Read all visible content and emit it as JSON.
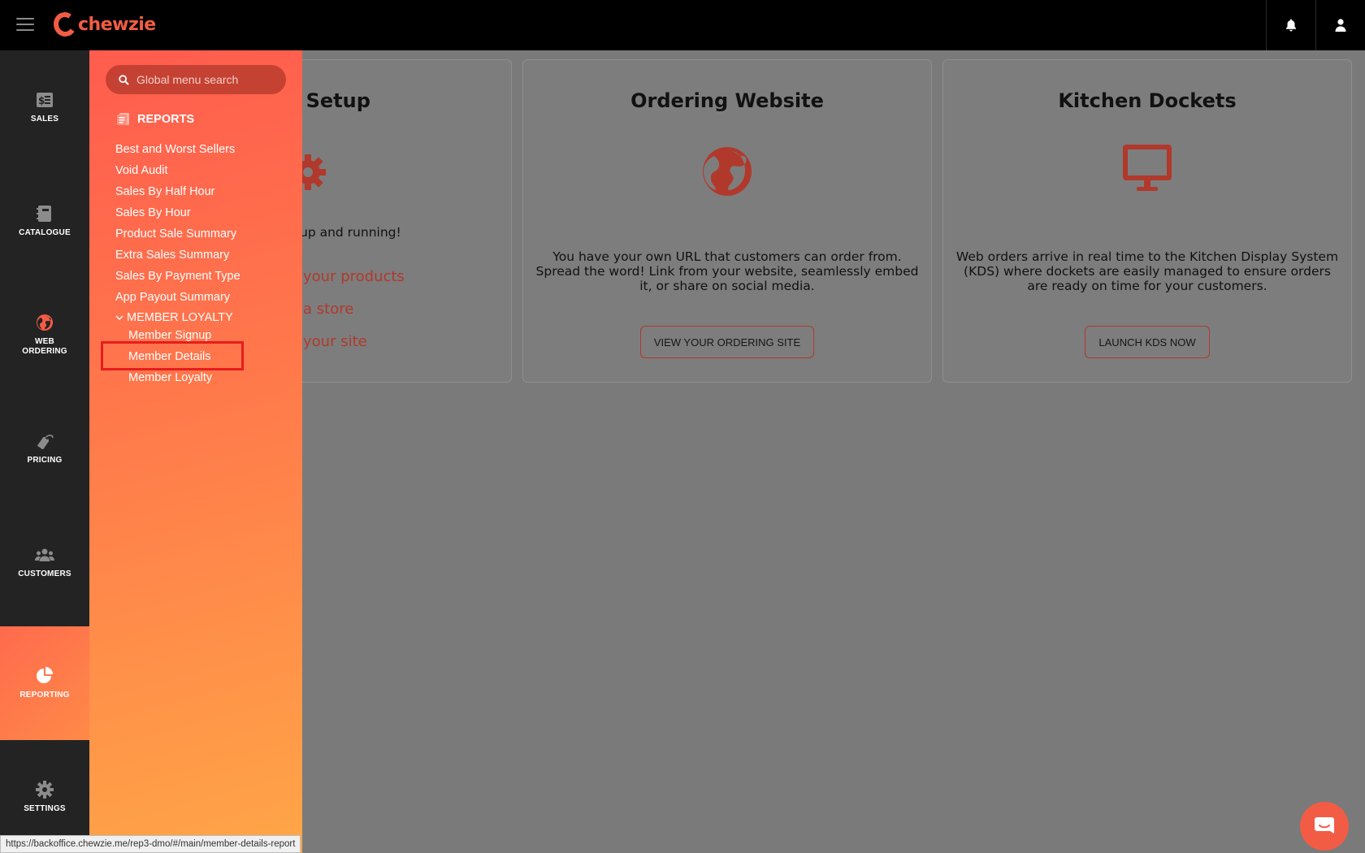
{
  "brand": {
    "name": "chewzie"
  },
  "topbar": {
    "notifications_icon": "bell-icon",
    "user_icon": "user-icon"
  },
  "nav": {
    "items": [
      {
        "label": "SALES",
        "icon": "sales-receipt-icon"
      },
      {
        "label": "CATALOGUE",
        "icon": "notebook-icon"
      },
      {
        "label": "WEB ORDERING",
        "icon": "globe-icon"
      },
      {
        "label": "PRICING",
        "icon": "price-tag-icon"
      },
      {
        "label": "CUSTOMERS",
        "icon": "people-icon"
      },
      {
        "label": "REPORTING",
        "icon": "pie-chart-icon",
        "active": true
      },
      {
        "label": "SETTINGS",
        "icon": "gear-icon"
      }
    ]
  },
  "flyout": {
    "search_placeholder": "Global menu search",
    "section_title": "REPORTS",
    "links": [
      "Best and Worst Sellers",
      "Void Audit",
      "Sales By Half Hour",
      "Sales By Hour",
      "Product Sale Summary",
      "Extra Sales Summary",
      "Sales By Payment Type",
      "App Payout Summary"
    ],
    "submenu_title": "MEMBER LOYALTY",
    "sub_links": [
      "Member Signup",
      "Member Details",
      "Member Loyalty"
    ],
    "highlighted": "Member Details"
  },
  "cards": {
    "setup": {
      "title_visible": "l Setup",
      "desc_visible": "up and running!",
      "links_visible": [
        "your products",
        "a store",
        "your site"
      ]
    },
    "ordering": {
      "title": "Ordering Website",
      "desc": "You have your own URL that customers can order from. Spread the word! Link from your website, seamlessly embed it, or share on social media.",
      "button": "VIEW YOUR ORDERING SITE"
    },
    "kitchen": {
      "title": "Kitchen Dockets",
      "desc": "Web orders arrive in real time to the Kitchen Display System (KDS) where dockets are easily managed to ensure orders are ready on time for your customers.",
      "button": "LAUNCH KDS NOW"
    }
  },
  "status_url": "https://backoffice.chewzie.me/rep3-dmo/#/main/member-details-report",
  "colors": {
    "accent": "#f25c45",
    "nav_bg": "#232323",
    "overlay_bg": "#7a7a7a",
    "highlight_border": "#e61d1d"
  }
}
